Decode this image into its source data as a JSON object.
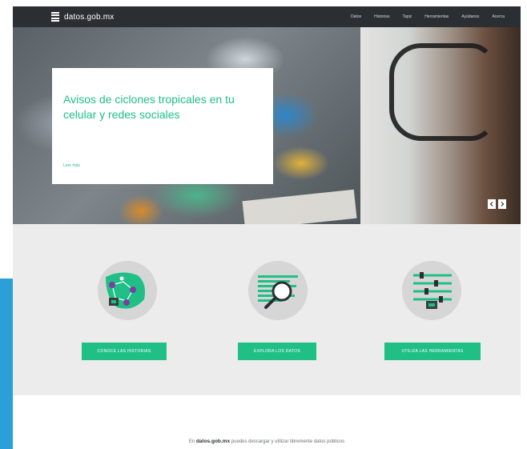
{
  "nav": {
    "logo_text": "datos.gob.mx",
    "items": [
      "Datos",
      "Historias",
      "Tapiz",
      "Herramientas",
      "Ayúdanos",
      "Acerca"
    ]
  },
  "hero": {
    "title": "Avisos de ciclones tropicales en tu celular y redes sociales",
    "read_more": "Leer más",
    "prev_icon": "chevron-left-icon",
    "next_icon": "chevron-right-icon"
  },
  "features": [
    {
      "button_label": "CONOCE LAS HISTORIAS",
      "icon": "map-network-icon"
    },
    {
      "button_label": "EXPLORA LOS DATOS",
      "icon": "magnifier-data-icon"
    },
    {
      "button_label": "UTILIZA LAS HERRAMIENTAS",
      "icon": "sliders-tools-icon"
    }
  ],
  "intro": {
    "prefix": "En",
    "site": "datos.gob.mx",
    "suffix": "puedes descargar y utilizar libremente datos públicos"
  },
  "colors": {
    "accent": "#1fbf86",
    "nav_bg": "#2b2f33",
    "section_bg": "#ececec",
    "side_bar": "#2a9fd8"
  }
}
